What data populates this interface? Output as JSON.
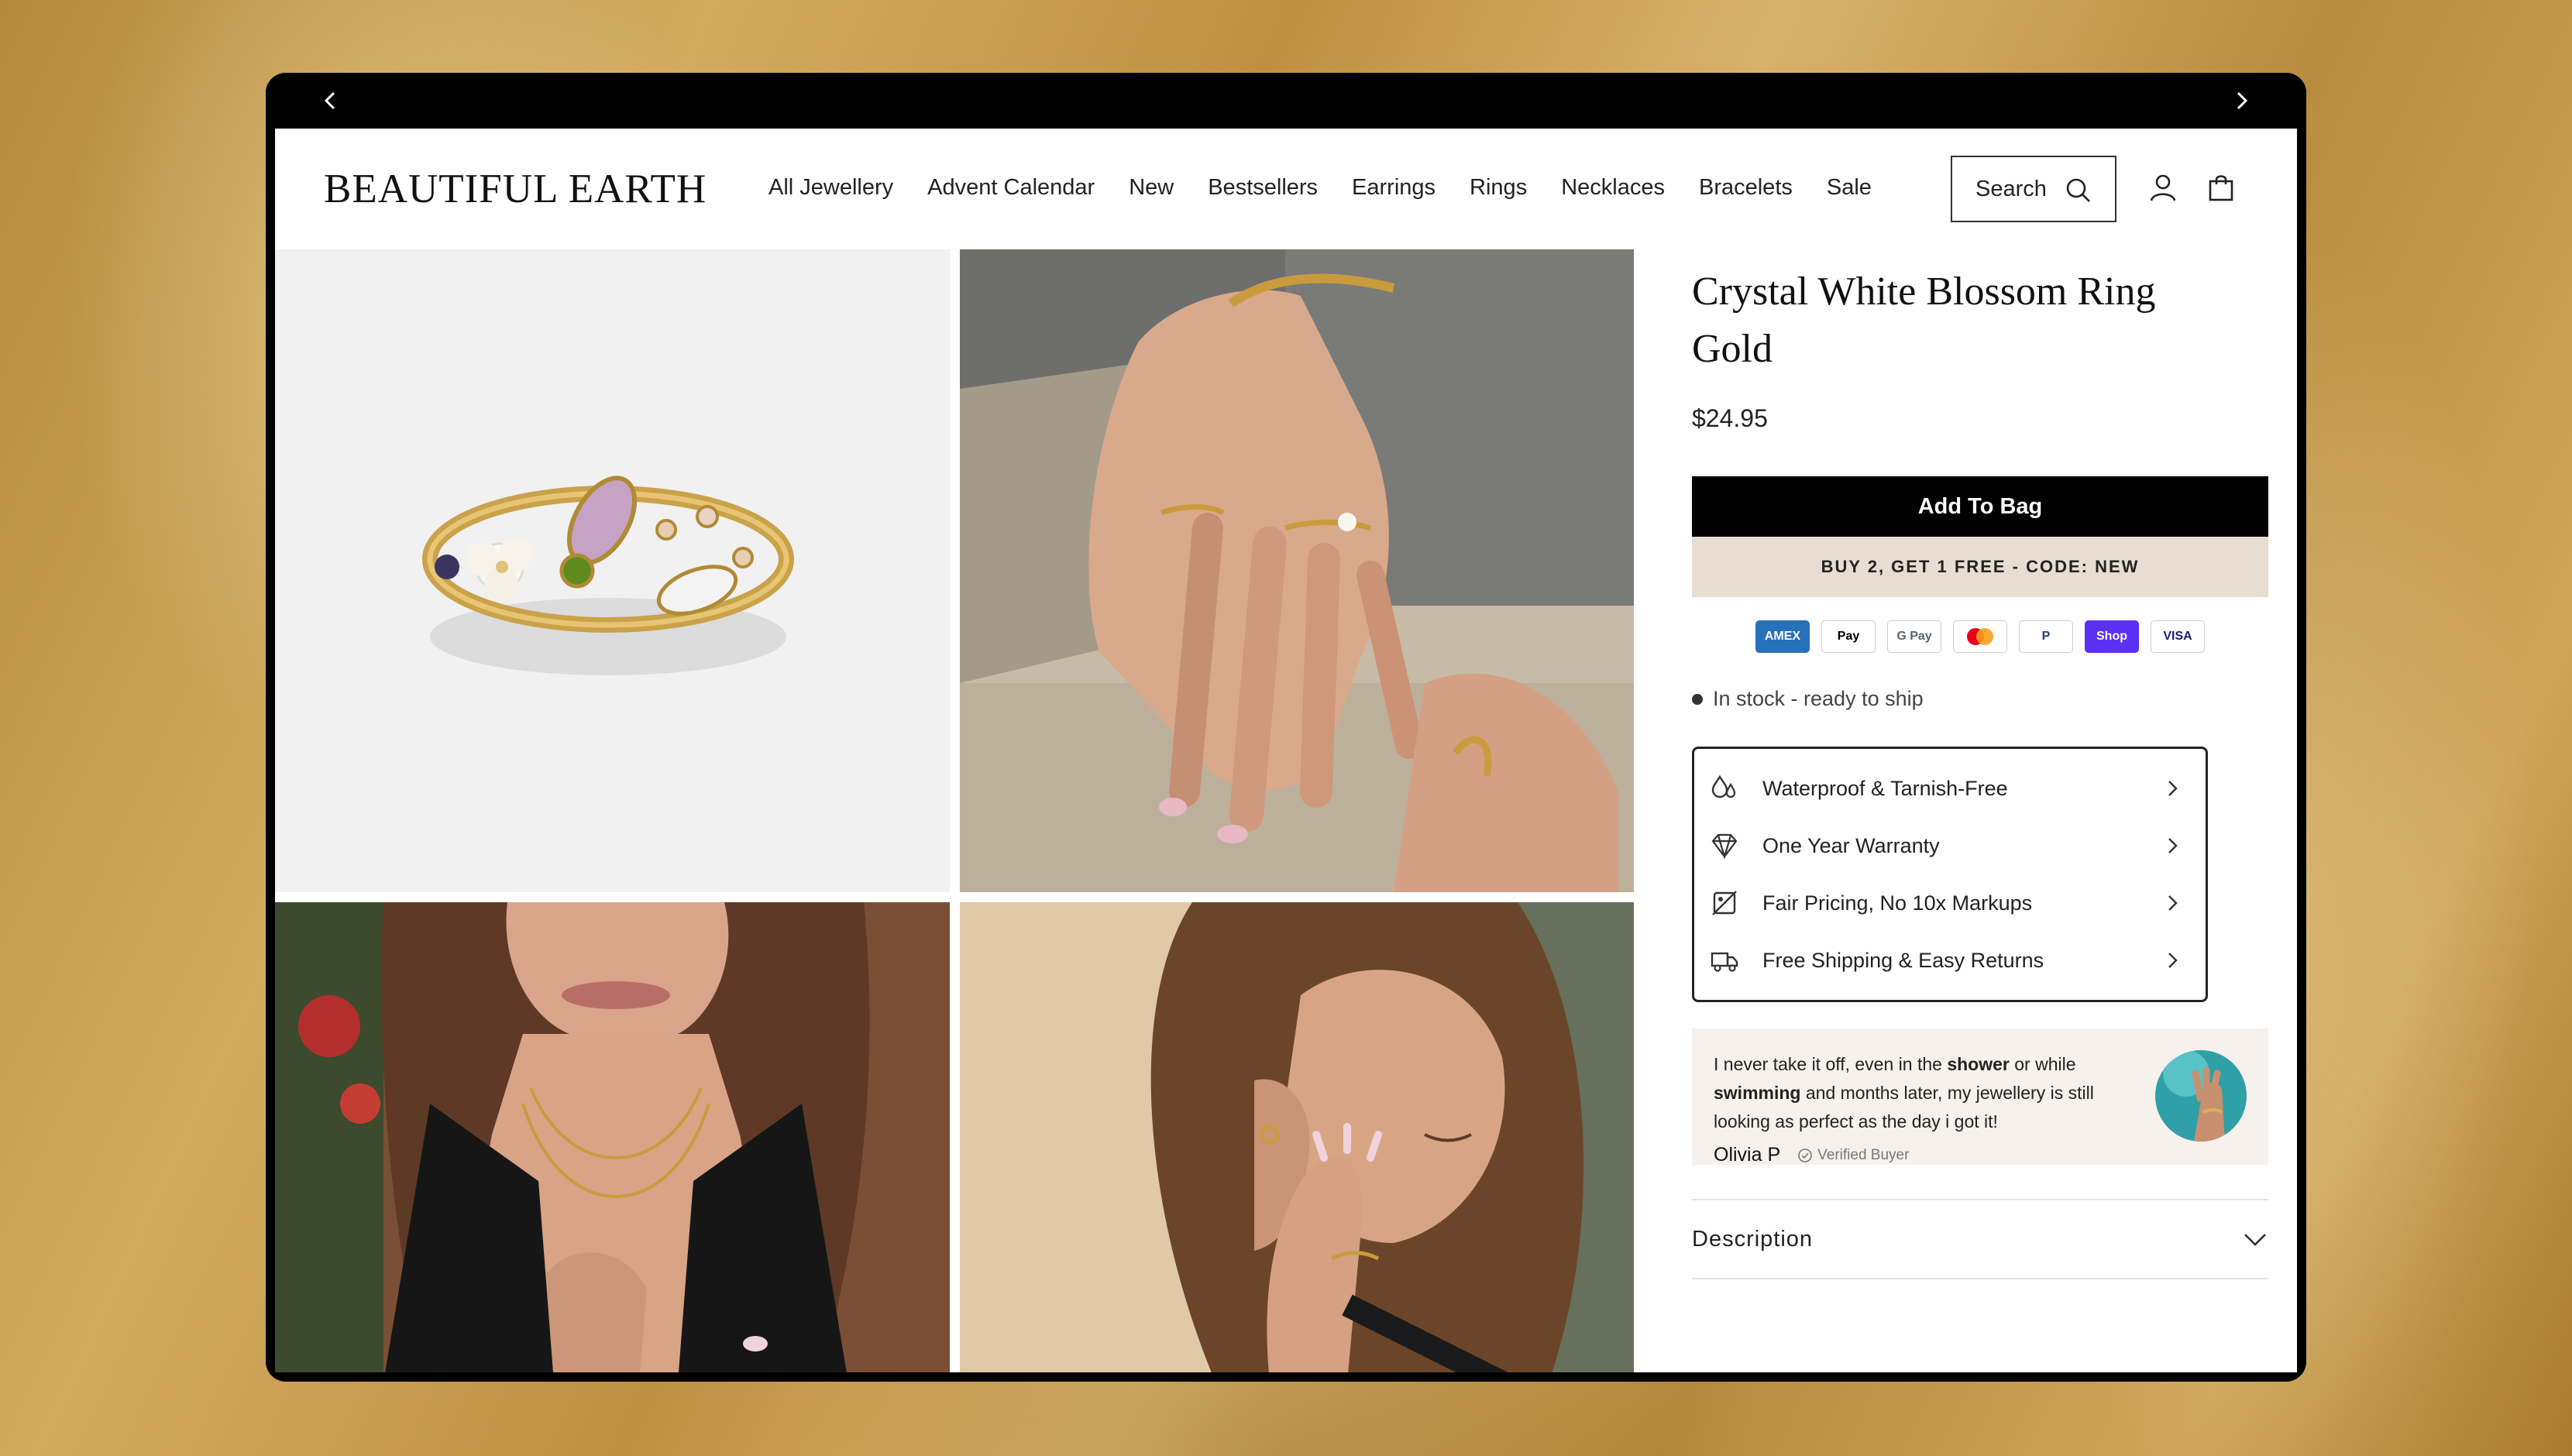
{
  "brand": {
    "logo": "BEAUTIFUL EARTH"
  },
  "nav": {
    "items": [
      "All Jewellery",
      "Advent Calendar",
      "New",
      "Bestsellers",
      "Earrings",
      "Rings",
      "Necklaces",
      "Bracelets",
      "Sale"
    ]
  },
  "search": {
    "label": "Search"
  },
  "product": {
    "title_line1": "Crystal White Blossom Ring",
    "title_line2": "Gold",
    "price": "$24.95",
    "add_to_bag": "Add To Bag",
    "promo": "BUY 2, GET 1 FREE - CODE: NEW",
    "stock": "In stock - ready to ship"
  },
  "payments": [
    {
      "label": "AMEX",
      "bg": "#2671b9",
      "fg": "#ffffff"
    },
    {
      "label": "Pay",
      "bg": "#ffffff",
      "fg": "#000000"
    },
    {
      "label": "G Pay",
      "bg": "#ffffff",
      "fg": "#5f6368"
    },
    {
      "label": "",
      "bg": "#ffffff",
      "fg": "#000000"
    },
    {
      "label": "P",
      "bg": "#ffffff",
      "fg": "#253b80"
    },
    {
      "label": "Shop",
      "bg": "#5a31f4",
      "fg": "#ffffff"
    },
    {
      "label": "VISA",
      "bg": "#ffffff",
      "fg": "#1a1f71"
    }
  ],
  "features": [
    {
      "label": "Waterproof & Tarnish-Free",
      "icon": "water-drops-icon"
    },
    {
      "label": "One Year Warranty",
      "icon": "diamond-icon"
    },
    {
      "label": "Fair Pricing, No 10x Markups",
      "icon": "price-tag-icon"
    },
    {
      "label": "Free Shipping & Easy Returns",
      "icon": "truck-icon"
    }
  ],
  "review": {
    "part1": "I never take it off, even in the ",
    "bold1": "shower",
    "part2": " or while ",
    "bold2": "swimming",
    "part3": " and months later, my jewellery is still looking as perfect as the day i got it!",
    "name": "Olivia P",
    "verified": "Verified Buyer"
  },
  "accordion": {
    "description": "Description"
  },
  "colors": {
    "accent": "#000000",
    "promo_bg": "#e8ddd1",
    "review_bg": "#f6f1ec"
  }
}
